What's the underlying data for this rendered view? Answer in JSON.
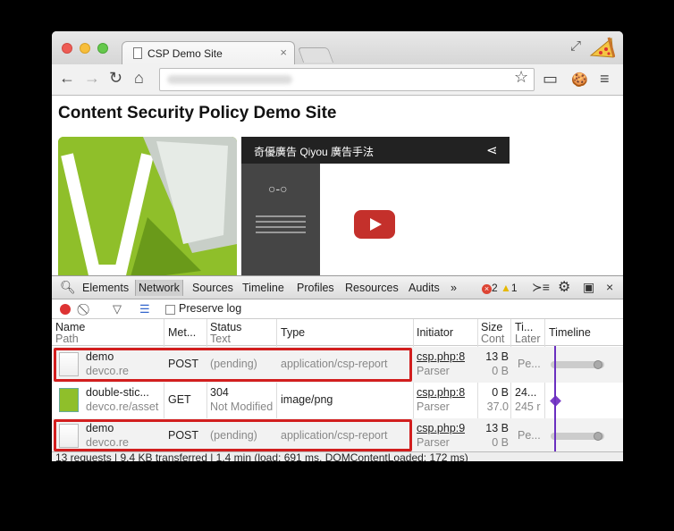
{
  "browser": {
    "tab_title": "CSP Demo Site",
    "tab_close": "×",
    "icons": {
      "back": "←",
      "forward": "→",
      "reload": "↻",
      "home": "⌂",
      "star": "☆",
      "cast": "▭",
      "cookie": "🍪",
      "menu": "≡"
    }
  },
  "page": {
    "title": "Content Security Policy Demo Site",
    "video_title": "奇優廣告 Qiyou 廣告手法"
  },
  "devtools": {
    "tabs": [
      "Elements",
      "Network",
      "Sources",
      "Timeline",
      "Profiles",
      "Resources",
      "Audits"
    ],
    "more": "»",
    "error_count": "2",
    "warning_count": "1",
    "preserve_log": "Preserve log",
    "columns": {
      "name": "Name",
      "name_sub": "Path",
      "method": "Met...",
      "status": "Status",
      "status_sub": "Text",
      "type": "Type",
      "initiator": "Initiator",
      "size": "Size",
      "size_sub": "Cont",
      "time": "Ti...",
      "time_sub": "Later",
      "timeline": "Timeline"
    },
    "rows": [
      {
        "name": "demo",
        "path": "devco.re",
        "method": "POST",
        "status": "(pending)",
        "status_text": "",
        "type": "application/csp-report",
        "initiator": "csp.php:8",
        "initiator_sub": "Parser",
        "size": "13 B",
        "content": "0 B",
        "time": "Pe...",
        "latency": ""
      },
      {
        "name": "double-stic...",
        "path": "devco.re/asset",
        "method": "GET",
        "status": "304",
        "status_text": "Not Modified",
        "type": "image/png",
        "initiator": "csp.php:8",
        "initiator_sub": "Parser",
        "size": "0 B",
        "content": "37.0",
        "time": "24...",
        "latency": "245 r"
      },
      {
        "name": "demo",
        "path": "devco.re",
        "method": "POST",
        "status": "(pending)",
        "status_text": "",
        "type": "application/csp-report",
        "initiator": "csp.php:9",
        "initiator_sub": "Parser",
        "size": "13 B",
        "content": "0 B",
        "time": "Pe...",
        "latency": ""
      }
    ],
    "status_bar": "13 requests | 9.4 KB transferred | 1.4 min (load: 691 ms, DOMContentLoaded: 172 ms)"
  }
}
